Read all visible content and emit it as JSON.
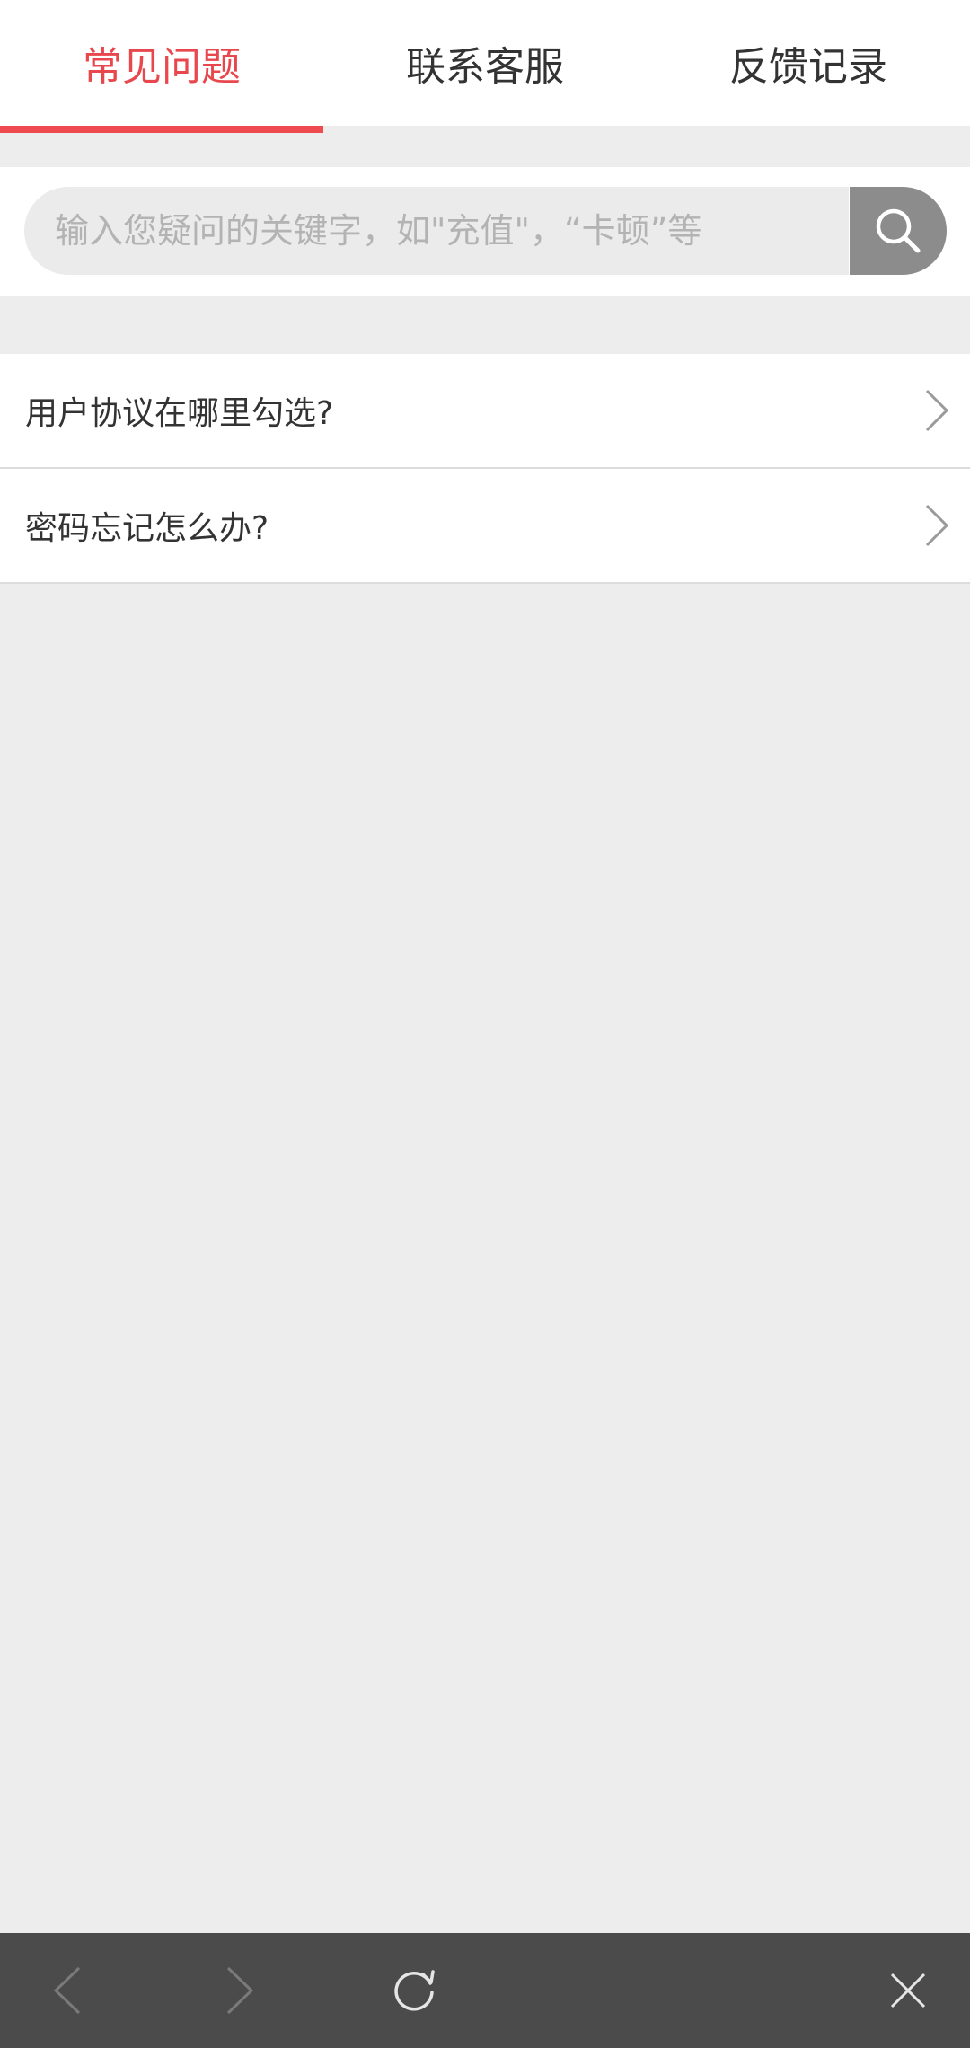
{
  "tabs": [
    {
      "label": "常见问题",
      "active": true
    },
    {
      "label": "联系客服",
      "active": false
    },
    {
      "label": "反馈记录",
      "active": false
    }
  ],
  "colors": {
    "accent": "#ef4a50",
    "background": "#ededed",
    "bottom_bar": "#4b4b4b",
    "search_button": "#8c8c8c"
  },
  "search": {
    "placeholder": "输入您疑问的关键字，如\"充值\"，“卡顿”等",
    "value": "",
    "button_icon": "search-icon"
  },
  "faq": {
    "items": [
      {
        "label": "用户协议在哪里勾选?",
        "icon": "chevron-right-icon"
      },
      {
        "label": "密码忘记怎么办?",
        "icon": "chevron-right-icon"
      }
    ]
  },
  "bottom_bar": {
    "back_icon": "back-arrow-icon",
    "forward_icon": "forward-arrow-icon",
    "refresh_icon": "refresh-icon",
    "close_icon": "close-icon"
  }
}
